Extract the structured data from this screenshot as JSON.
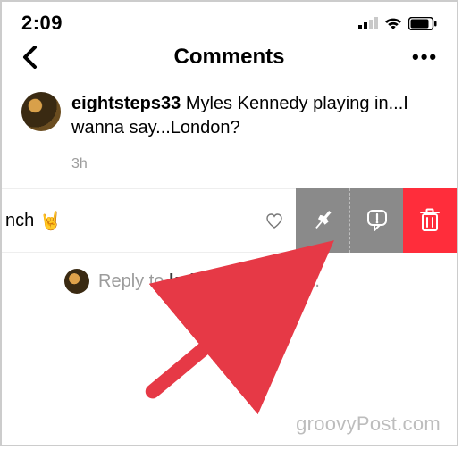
{
  "statusbar": {
    "time": "2:09"
  },
  "header": {
    "title": "Comments",
    "more": "•••"
  },
  "comment1": {
    "username": "eightsteps33",
    "text": " Myles Kennedy playing in...I wanna say...London?",
    "age": "3h"
  },
  "swiped": {
    "visible_fragment": "nch ",
    "emoji": "🤘"
  },
  "reply": {
    "prefix": "Reply to ",
    "handle": "kokopelli_ranch",
    "suffix": "..."
  },
  "watermark": "groovyPost.com",
  "icons": {
    "back": "back-chevron",
    "signal": "cell-signal",
    "wifi": "wifi",
    "battery": "battery",
    "heart": "heart-outline",
    "pin": "pushpin",
    "report": "report-speech",
    "trash": "trash"
  }
}
